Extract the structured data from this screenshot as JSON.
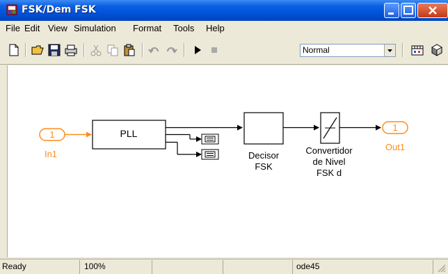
{
  "window": {
    "title": "FSK/Dem FSK"
  },
  "menu": [
    "File",
    "Edit",
    "View",
    "Simulation",
    "Format",
    "Tools",
    "Help"
  ],
  "toolbar": {
    "mode": "Normal"
  },
  "diagram": {
    "inport": {
      "number": "1",
      "label": "In1"
    },
    "pll": {
      "label": "PLL"
    },
    "decisor": {
      "line1": "Decisor",
      "line2": "FSK"
    },
    "convertidor": {
      "line1": "Convertidor",
      "line2": "de Nivel",
      "line3": "FSK d"
    },
    "outport": {
      "number": "1",
      "label": "Out1"
    },
    "port_color": "#ff8c1a"
  },
  "status": {
    "state": "Ready",
    "zoom": "100%",
    "solver": "ode45"
  }
}
